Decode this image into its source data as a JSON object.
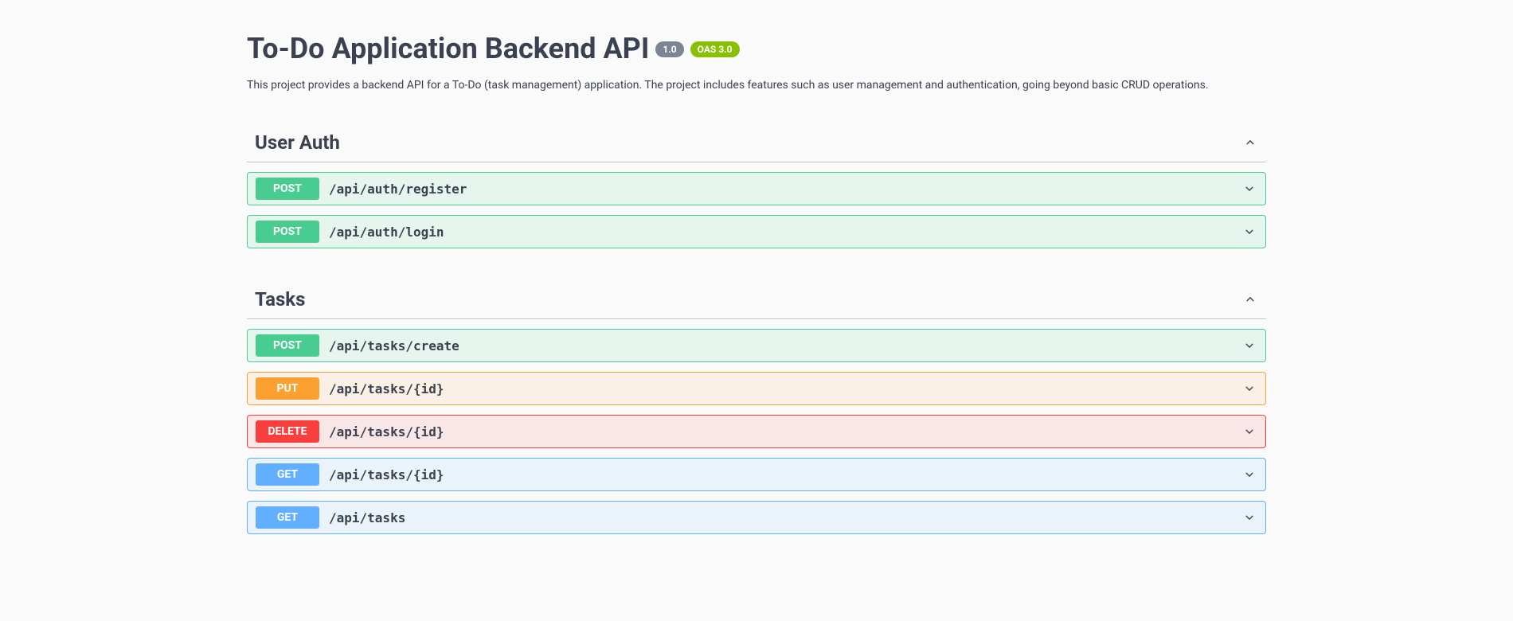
{
  "header": {
    "title": "To-Do Application Backend API",
    "version_badge": "1.0",
    "oas_badge": "OAS 3.0",
    "description": "This project provides a backend API for a To-Do (task management) application. The project includes features such as user management and authentication, going beyond basic CRUD operations."
  },
  "sections": [
    {
      "name": "User Auth",
      "operations": [
        {
          "method": "POST",
          "method_class": "post",
          "path": "/api/auth/register"
        },
        {
          "method": "POST",
          "method_class": "post",
          "path": "/api/auth/login"
        }
      ]
    },
    {
      "name": "Tasks",
      "operations": [
        {
          "method": "POST",
          "method_class": "post",
          "path": "/api/tasks/create"
        },
        {
          "method": "PUT",
          "method_class": "put",
          "path": "/api/tasks/{id}"
        },
        {
          "method": "DELETE",
          "method_class": "delete",
          "path": "/api/tasks/{id}"
        },
        {
          "method": "GET",
          "method_class": "get",
          "path": "/api/tasks/{id}"
        },
        {
          "method": "GET",
          "method_class": "get",
          "path": "/api/tasks"
        }
      ]
    }
  ]
}
